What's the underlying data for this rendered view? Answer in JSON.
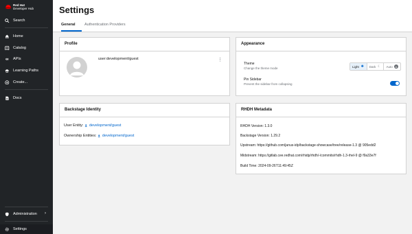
{
  "sidebar": {
    "logo": {
      "line1": "Red Hat",
      "line2": "Developer Hub"
    },
    "search_label": "Search",
    "items": [
      {
        "label": "Home",
        "icon": "home-icon"
      },
      {
        "label": "Catalog",
        "icon": "catalog-icon"
      },
      {
        "label": "APIs",
        "icon": "apis-icon"
      },
      {
        "label": "Learning Paths",
        "icon": "school-icon"
      },
      {
        "label": "Create...",
        "icon": "add-circle-icon"
      },
      {
        "label": "Docs",
        "icon": "docs-icon"
      }
    ],
    "administration_label": "Administration",
    "settings_label": "Settings"
  },
  "header": {
    "title": "Settings",
    "tabs": [
      {
        "label": "General",
        "active": true
      },
      {
        "label": "Authentication Providers",
        "active": false
      }
    ]
  },
  "profile": {
    "title": "Profile",
    "user": "user:development/guest"
  },
  "appearance": {
    "title": "Appearance",
    "theme_label": "Theme",
    "theme_desc": "Change the theme mode",
    "theme_options": [
      "Light",
      "Dark",
      "Auto"
    ],
    "selected_theme": "Light",
    "pin_label": "Pin Sidebar",
    "pin_desc": "Prevent the sidebar from collapsing",
    "pin_enabled": true
  },
  "identity": {
    "title": "Backstage Identity",
    "user_entity_label": "User Entity:",
    "user_entity_value": "development/guest",
    "ownership_label": "Ownership Entities:",
    "ownership_value": "development/guest"
  },
  "metadata": {
    "title": "RHDH Metadata",
    "lines": [
      "RHDH Version: 1.3.0",
      "Backstage Version: 1.29.2",
      "Upstream: https://github.com/janus-idp/backstage-showcase/tree/release-1.3 @ 905edd2",
      "Midstream: https://gitlab.cee.redhat.com/rhidp/rhdh/-/commits/rhdh-1.3-rhel-9 @ f9a33e7f",
      "Build Time: 2024-09-26T11:49:45Z"
    ]
  },
  "colors": {
    "accent": "#0066cc",
    "sidebar_bg": "#212427",
    "logo_red": "#ee0000"
  }
}
